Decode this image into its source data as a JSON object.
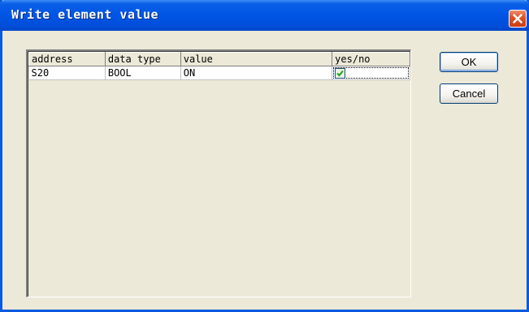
{
  "window": {
    "title": "Write element value"
  },
  "grid": {
    "columns": [
      "address",
      "data type",
      "value",
      "yes/no"
    ],
    "rows": [
      {
        "address": "S20",
        "data_type": "BOOL",
        "value": "ON",
        "checked": true
      }
    ]
  },
  "buttons": {
    "ok_label": "OK",
    "cancel_label": "Cancel"
  },
  "colors": {
    "titlebar": "#0055e5",
    "close_button": "#e0542a",
    "check_mark": "#21a121"
  }
}
